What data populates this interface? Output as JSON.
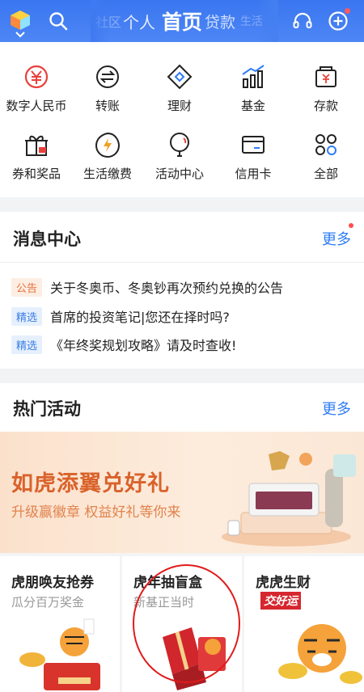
{
  "header": {
    "tabs": [
      "社区",
      "个人",
      "首页",
      "贷款",
      "生活"
    ],
    "active_tab": "首页",
    "notification_dot_color": "#ff5a5f",
    "icons": [
      "app-logo-icon",
      "search-icon",
      "headset-icon",
      "add-icon"
    ]
  },
  "services": [
    {
      "label": "数字人民币",
      "icon": "digital-rmb-icon"
    },
    {
      "label": "转账",
      "icon": "transfer-icon"
    },
    {
      "label": "理财",
      "icon": "wealth-icon"
    },
    {
      "label": "基金",
      "icon": "fund-icon"
    },
    {
      "label": "存款",
      "icon": "deposit-icon"
    },
    {
      "label": "券和奖品",
      "icon": "coupon-icon"
    },
    {
      "label": "生活缴费",
      "icon": "bill-pay-icon"
    },
    {
      "label": "活动中心",
      "icon": "activity-center-icon"
    },
    {
      "label": "信用卡",
      "icon": "credit-card-icon"
    },
    {
      "label": "全部",
      "icon": "all-services-icon"
    }
  ],
  "message_center": {
    "title": "消息中心",
    "more_label": "更多",
    "items": [
      {
        "tag": "公告",
        "text": "关于冬奥币、冬奥钞再次预约兑换的公告"
      },
      {
        "tag": "精选",
        "text": "首席的投资笔记|您还在择时吗?"
      },
      {
        "tag": "精选",
        "text": "《年终奖规划攻略》请及时查收!"
      }
    ]
  },
  "hot_activities": {
    "title": "热门活动",
    "more_label": "更多",
    "banner": {
      "title": "如虎添翼兑好礼",
      "subtitle": "升级赢徽章 权益好礼等你来"
    },
    "tiles": [
      {
        "title": "虎朋唤友抢券",
        "subtitle": "瓜分百万奖金"
      },
      {
        "title": "虎年抽盲盒",
        "subtitle": "新基正当时"
      },
      {
        "title": "虎虎生财",
        "badge": "交好运"
      }
    ]
  },
  "colors": {
    "header_blue": "#3a76f0",
    "accent_red": "#e8413c",
    "link_blue": "#2e7cf6",
    "banner_orange": "#d9622b"
  }
}
